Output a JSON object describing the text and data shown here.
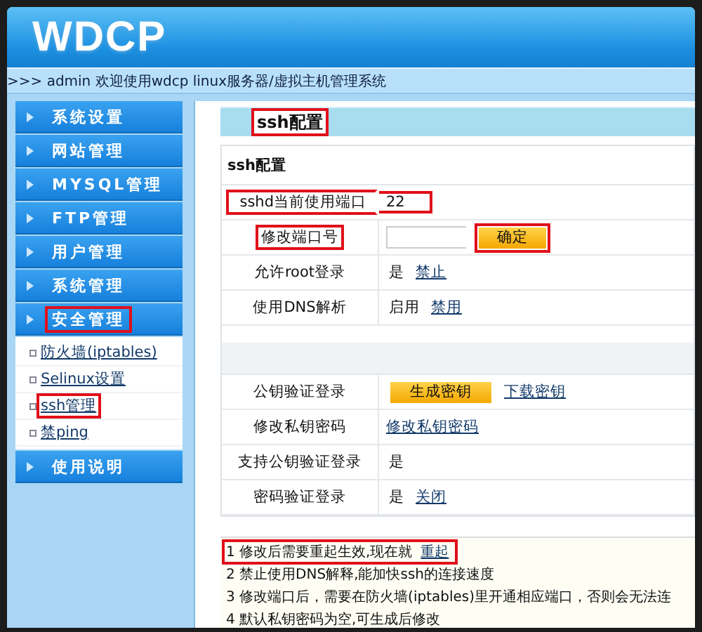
{
  "logo": "WDCP",
  "breadcrumb": ">>> admin 欢迎使用wdcp linux服务器/虚拟主机管理系统",
  "sidebar": {
    "items": [
      {
        "label": "系统设置",
        "highlighted": false
      },
      {
        "label": "网站管理",
        "highlighted": false
      },
      {
        "label": "MYSQL管理",
        "highlighted": false
      },
      {
        "label": "FTP管理",
        "highlighted": false
      },
      {
        "label": "用户管理",
        "highlighted": false
      },
      {
        "label": "系统管理",
        "highlighted": false
      },
      {
        "label": "安全管理",
        "highlighted": true,
        "children": [
          {
            "label": "防火墙(iptables)",
            "highlighted": false
          },
          {
            "label": "Selinux设置",
            "highlighted": false
          },
          {
            "label": "ssh管理",
            "highlighted": true
          },
          {
            "label": "禁ping",
            "highlighted": false
          }
        ]
      },
      {
        "label": "使用说明",
        "highlighted": false
      }
    ]
  },
  "tab": {
    "label": "ssh配置",
    "highlighted": true
  },
  "section_title": "ssh配置",
  "settings": [
    {
      "label": "sshd当前使用端口",
      "highlighted": true,
      "label_highlighted": false,
      "parts": [
        {
          "kind": "text",
          "text": "22"
        }
      ]
    },
    {
      "label": "修改端口号",
      "highlighted": false,
      "label_highlighted": true,
      "parts": [
        {
          "kind": "input"
        },
        {
          "kind": "button",
          "text": "确定",
          "highlighted": true
        }
      ]
    },
    {
      "label": "允许root登录",
      "highlighted": false,
      "label_highlighted": false,
      "parts": [
        {
          "kind": "text",
          "text": "是"
        },
        {
          "kind": "link",
          "text": "禁止"
        }
      ]
    },
    {
      "label": "使用DNS解析",
      "highlighted": false,
      "label_highlighted": false,
      "parts": [
        {
          "kind": "text",
          "text": "启用"
        },
        {
          "kind": "link",
          "text": "禁用"
        }
      ]
    }
  ],
  "key_settings": [
    {
      "label": "公钥验证登录",
      "highlighted": false,
      "label_highlighted": false,
      "parts": [
        {
          "kind": "button",
          "text": "生成密钥",
          "highlighted": false
        },
        {
          "kind": "link",
          "text": "下载密钥"
        }
      ]
    },
    {
      "label": "修改私钥密码",
      "highlighted": false,
      "label_highlighted": false,
      "parts": [
        {
          "kind": "link",
          "text": "修改私钥密码"
        }
      ]
    },
    {
      "label": "支持公钥验证登录",
      "highlighted": false,
      "label_highlighted": false,
      "parts": [
        {
          "kind": "text",
          "text": "是"
        }
      ]
    },
    {
      "label": "密码验证登录",
      "highlighted": false,
      "label_highlighted": false,
      "parts": [
        {
          "kind": "text",
          "text": "是"
        },
        {
          "kind": "link",
          "text": "关闭"
        }
      ]
    }
  ],
  "notes": [
    {
      "text": "1 修改后需要重起生效,现在就",
      "link": "重起",
      "highlighted": true
    },
    {
      "text": "2 禁止使用DNS解释,能加快ssh的连接速度",
      "highlighted": false
    },
    {
      "text": "3 修改端口后，需要在防火墙(iptables)里开通相应端口，否则会无法连",
      "highlighted": false
    },
    {
      "text": "4 默认私钥密码为空,可生成后修改",
      "highlighted": false
    }
  ]
}
